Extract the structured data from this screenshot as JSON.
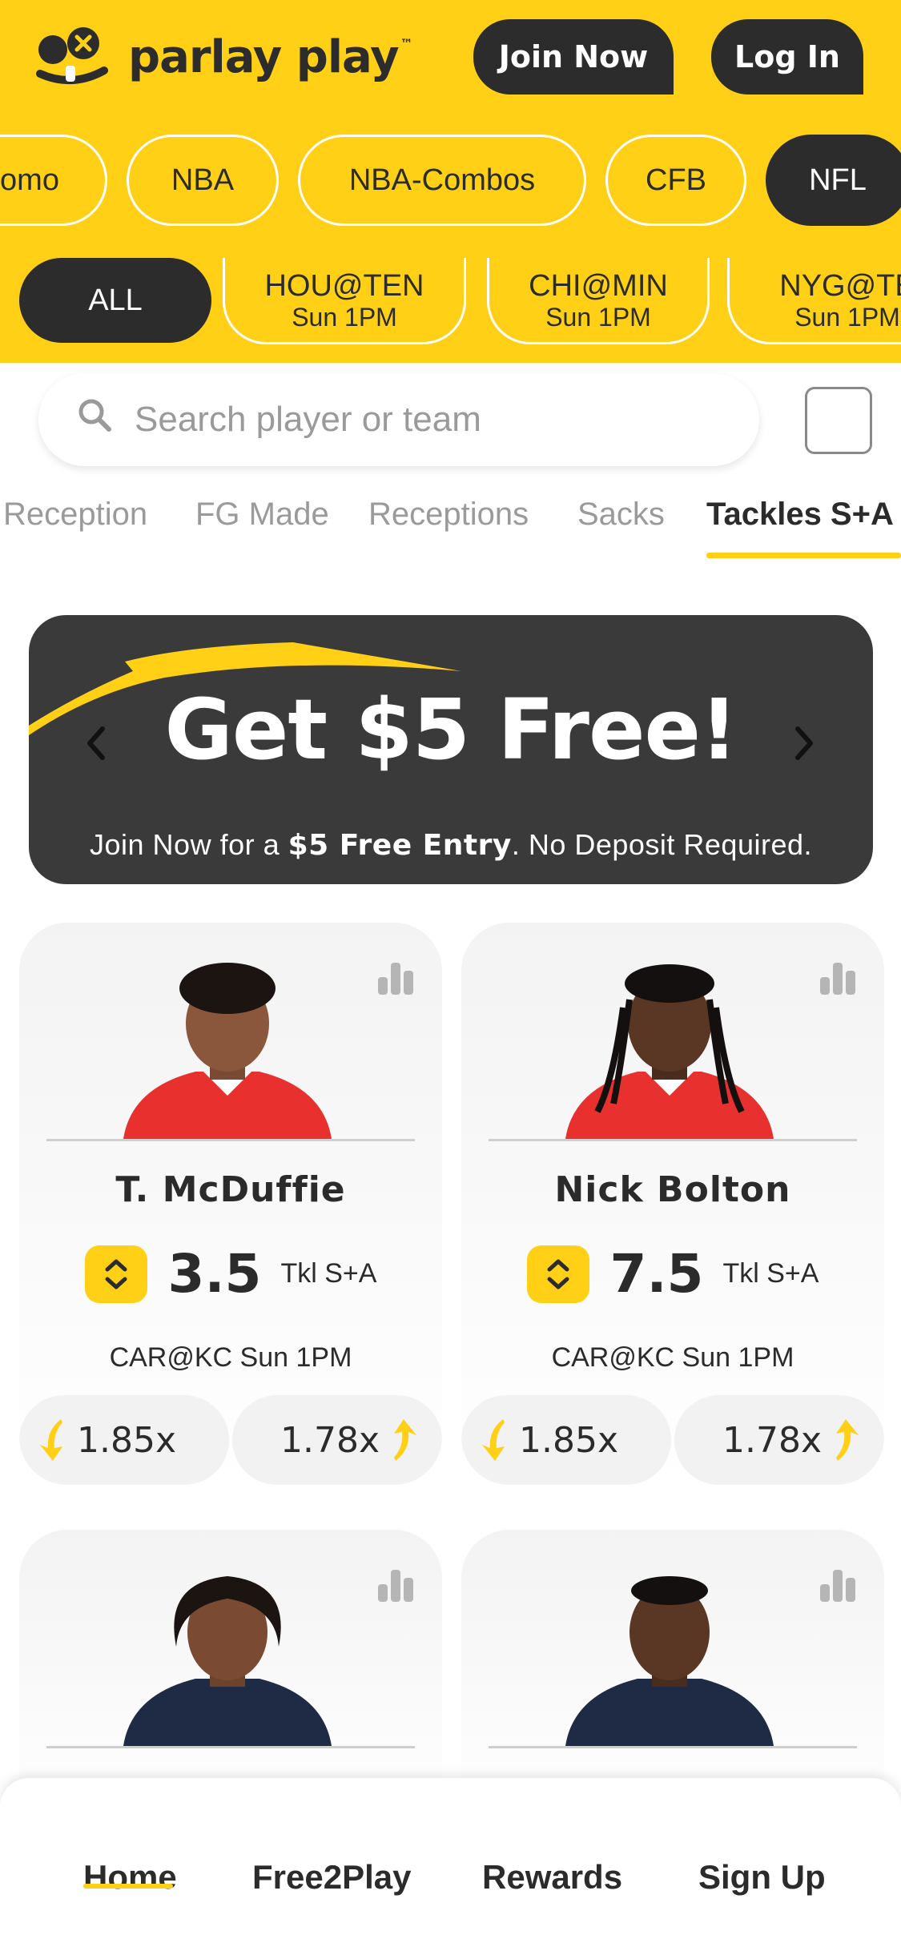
{
  "header": {
    "logo_text": "parlay play",
    "logo_tm": "™",
    "join_label": "Join Now",
    "login_label": "Log In"
  },
  "sports": [
    {
      "label": "omo"
    },
    {
      "label": "NBA"
    },
    {
      "label": "NBA-Combos"
    },
    {
      "label": "CFB"
    },
    {
      "label": "NFL",
      "active": true
    }
  ],
  "games": {
    "all_label": "ALL",
    "items": [
      {
        "matchup": "HOU@TEN",
        "time": "Sun 1PM"
      },
      {
        "matchup": "CHI@MIN",
        "time": "Sun 1PM"
      },
      {
        "matchup": "NYG@TE",
        "time": "Sun 1PM"
      }
    ]
  },
  "search": {
    "placeholder": "Search player or team",
    "value": ""
  },
  "stat_tabs": [
    {
      "label": "Reception"
    },
    {
      "label": "FG Made"
    },
    {
      "label": "Receptions"
    },
    {
      "label": "Sacks"
    },
    {
      "label": "Tackles S+A",
      "active": true
    }
  ],
  "banner": {
    "title": "Get $5 Free!",
    "sub_prefix": "Join Now for a ",
    "sub_bold": "$5 Free Entry",
    "sub_suffix": ". No Deposit Required."
  },
  "cards": [
    {
      "name": "T. McDuffie",
      "line": "3.5",
      "stat": "Tkl S+A",
      "matchup": "CAR@KC Sun 1PM",
      "under": "1.85x",
      "over": "1.78x",
      "jersey": "#e8312f"
    },
    {
      "name": "Nick Bolton",
      "line": "7.5",
      "stat": "Tkl S+A",
      "matchup": "CAR@KC Sun 1PM",
      "under": "1.85x",
      "over": "1.78x",
      "jersey": "#e8312f"
    },
    {
      "name": "",
      "jersey": "#1f2a44"
    },
    {
      "name": "",
      "jersey": "#1f2a44"
    }
  ],
  "nav": {
    "home": "Home",
    "free2play": "Free2Play",
    "rewards": "Rewards",
    "signup": "Sign Up"
  },
  "colors": {
    "brand_yellow": "#ffd016",
    "dark": "#2c2c2c",
    "banner_bg": "#3a3a3a"
  }
}
